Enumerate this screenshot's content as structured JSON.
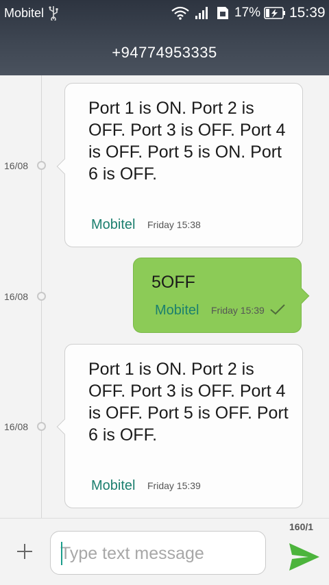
{
  "status_bar": {
    "carrier": "Mobitel",
    "battery_percent": "17%",
    "time": "15:39",
    "icons": [
      "usb-icon",
      "wifi-icon",
      "signal-icon",
      "sim-icon",
      "battery-charging-icon"
    ]
  },
  "header": {
    "contact": "+94774953335"
  },
  "messages": [
    {
      "direction": "incoming",
      "date": "16/08",
      "text": "Port 1 is ON.  Port 2 is OFF.  Port 3 is OFF.  Port 4 is OFF.  Port 5 is ON.  Port 6 is OFF.",
      "sim": "Mobitel",
      "time": "Friday 15:38"
    },
    {
      "direction": "outgoing",
      "date": "16/08",
      "text": "5OFF",
      "sim": "Mobitel",
      "time": "Friday 15:39",
      "delivered": true
    },
    {
      "direction": "incoming",
      "date": "16/08",
      "text": "Port 1 is ON.  Port 2 is OFF.  Port 3 is OFF.  Port 4 is OFF.  Port 5 is OFF.  Port 6 is OFF.",
      "sim": "Mobitel",
      "time": "Friday 15:39"
    }
  ],
  "composer": {
    "placeholder": "Type text message",
    "value": "",
    "counter": "160/1"
  },
  "colors": {
    "header": "#3a414d",
    "outgoing_bubble": "#8ccb57",
    "accent": "#1b7f6e",
    "send": "#4cb43c"
  }
}
